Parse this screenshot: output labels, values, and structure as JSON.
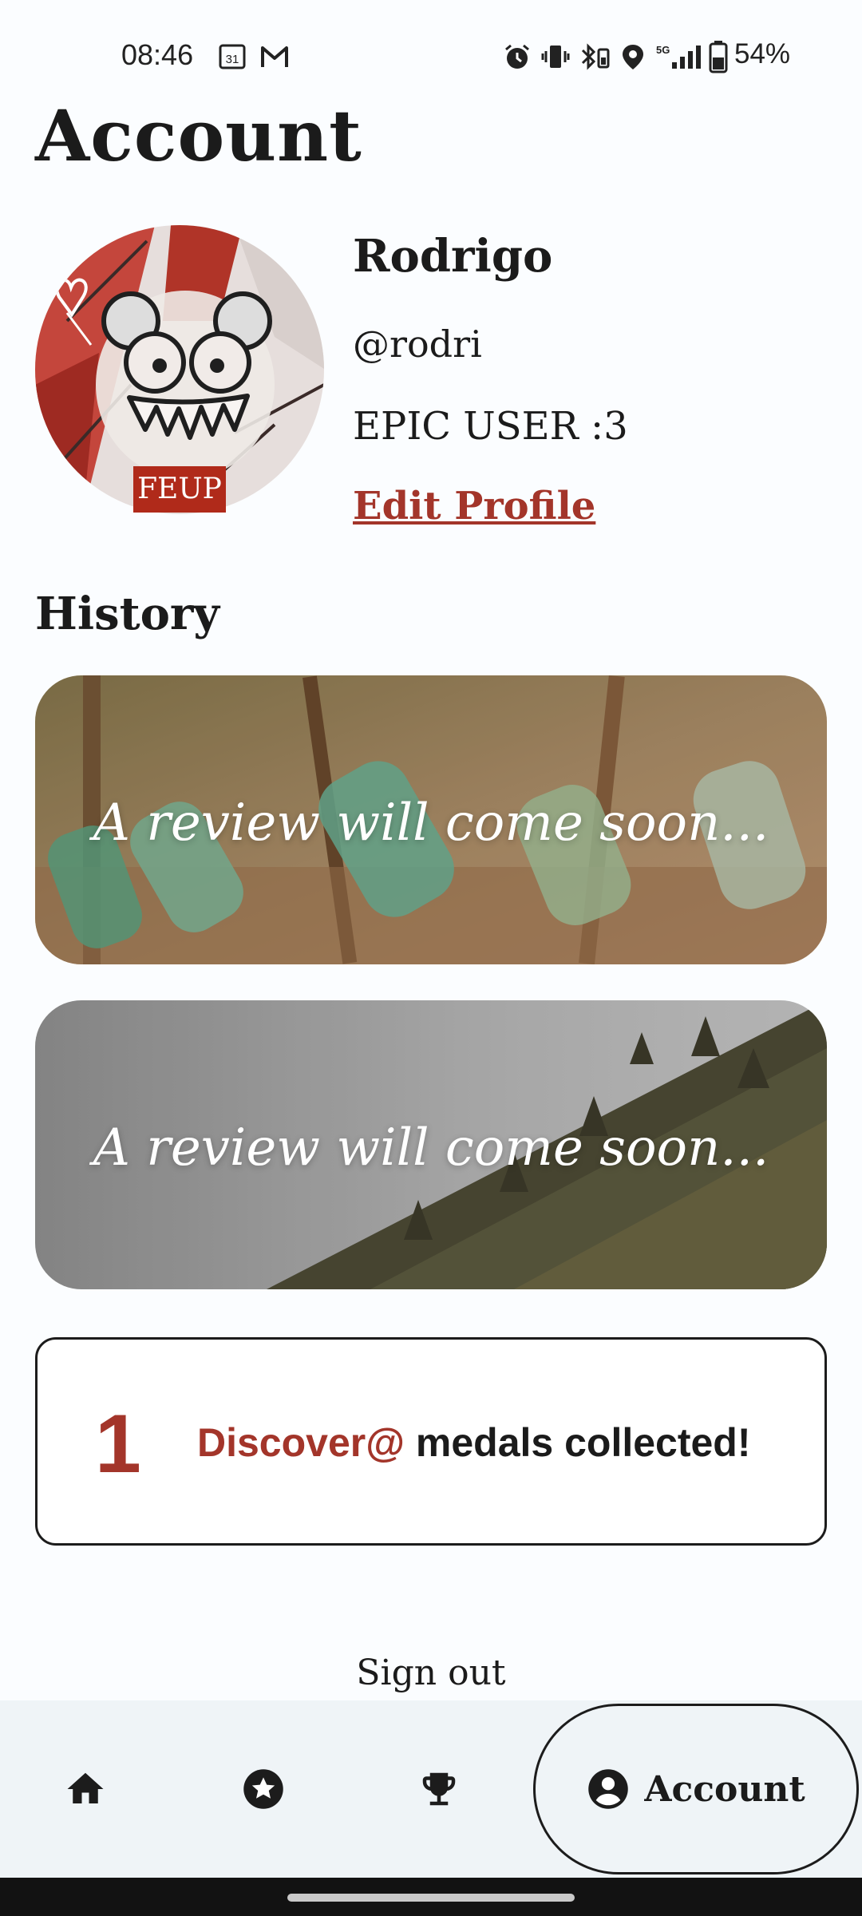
{
  "status_bar": {
    "time": "08:46",
    "calendar_day": "31",
    "network": "5G",
    "battery": "54%"
  },
  "page_title": "Account",
  "profile": {
    "name": "Rodrigo",
    "handle": "@rodri",
    "bio": "EPIC USER :3",
    "edit_label": "Edit Profile",
    "avatar_badge": "FEUP"
  },
  "history": {
    "heading": "History",
    "cards": [
      {
        "caption": "A review will come soon..."
      },
      {
        "caption": "A review will come soon..."
      }
    ]
  },
  "medals": {
    "count": "1",
    "brand": "Discover@",
    "text": " medals collected!"
  },
  "sign_out_label": "Sign out",
  "nav": {
    "items": [
      {
        "icon": "home-icon"
      },
      {
        "icon": "star-circle-icon"
      },
      {
        "icon": "trophy-icon"
      },
      {
        "icon": "account-circle-icon",
        "label": "Account",
        "active": true
      }
    ]
  },
  "colors": {
    "accent": "#a3352a",
    "background": "#fbfdff",
    "nav_background": "#eff4f7"
  }
}
